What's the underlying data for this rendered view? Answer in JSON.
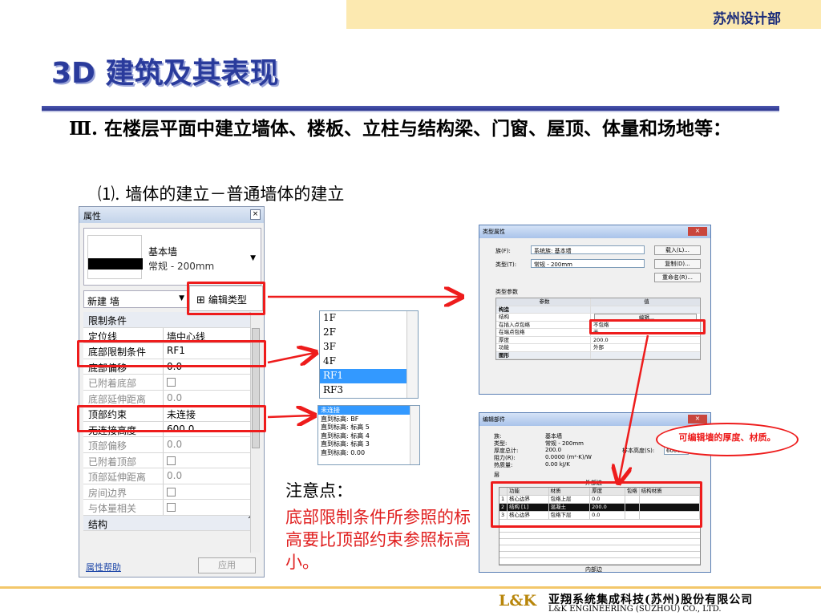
{
  "header": {
    "dept": "苏州设计部"
  },
  "title": "3D 建筑及其表现",
  "section": {
    "heading": "Ⅲ. 在楼层平面中建立墙体、楼板、立柱与结构梁、门窗、屋顶、体量和场地等：",
    "subheading": "⑴.  墙体的建立－普通墙体的建立"
  },
  "props": {
    "title": "属性",
    "type_name": "基本墙",
    "type_sub": "常规 - 200mm",
    "new_label": "新建 墙",
    "edit_type": "编辑类型",
    "rows": [
      {
        "k": "限制条件",
        "v": "",
        "grp": true
      },
      {
        "k": "定位线",
        "v": "墙中心线"
      },
      {
        "k": "底部限制条件",
        "v": "RF1"
      },
      {
        "k": "底部偏移",
        "v": "0.0"
      },
      {
        "k": "已附着底部",
        "v": "",
        "cb": true,
        "dis": true
      },
      {
        "k": "底部延伸距离",
        "v": "0.0",
        "dis": true
      },
      {
        "k": "顶部约束",
        "v": "未连接"
      },
      {
        "k": "无连接高度",
        "v": "600.0"
      },
      {
        "k": "顶部偏移",
        "v": "0.0",
        "dis": true
      },
      {
        "k": "已附着顶部",
        "v": "",
        "cb": true,
        "dis": true
      },
      {
        "k": "顶部延伸距离",
        "v": "0.0",
        "dis": true
      },
      {
        "k": "房间边界",
        "v": "",
        "cb": true,
        "dis": true
      },
      {
        "k": "与体量相关",
        "v": "",
        "cb": true,
        "dis": true
      },
      {
        "k": "结构",
        "v": "",
        "grp": true
      }
    ],
    "help": "属性帮助",
    "apply": "应用"
  },
  "levels": [
    "1F",
    "2F",
    "3F",
    "4F",
    "RF1",
    "RF3"
  ],
  "levels_selected": 4,
  "top_constraints": [
    "未连接",
    "直到标高: BF",
    "直到标高: 标高 5",
    "直到标高: 标高 4",
    "直到标高: 标高 3",
    "直到标高: 0.00"
  ],
  "type_dialog": {
    "title": "类型属性",
    "family_label": "族(F):",
    "family_value": "系统族: 基本墙",
    "type_label": "类型(T):",
    "type_value": "常规 - 200mm",
    "load": "载入(L)...",
    "dup": "复制(D)...",
    "rename": "重命名(R)...",
    "params_label": "类型参数",
    "col_param": "参数",
    "col_value": "值",
    "rows": [
      {
        "a": "构造",
        "b": "",
        "h": true
      },
      {
        "a": "结构",
        "b": "编辑..."
      },
      {
        "a": "在插入点包络",
        "b": "不包络"
      },
      {
        "a": "在端点包络",
        "b": "无"
      },
      {
        "a": "厚度",
        "b": "200.0"
      },
      {
        "a": "功能",
        "b": "外部"
      },
      {
        "a": "图形",
        "b": "",
        "h": true
      }
    ]
  },
  "assembly": {
    "title": "编辑部件",
    "family": "族:",
    "family_v": "基本墙",
    "type": "类型:",
    "type_v": "常规 - 200mm",
    "thick": "厚度总计:",
    "thick_v": "200.0",
    "res": "阻力(R):",
    "res_v": "0.0000 (m²·K)/W",
    "mass": "热质量:",
    "mass_v": "0.00 kJ/K",
    "sample": "样本高度(S):",
    "sample_v": "6000.0",
    "layers_label": "层",
    "ext": "外部边",
    "int": "内部边",
    "cols": [
      "",
      "功能",
      "材质",
      "厚度",
      "包络",
      "结构材质"
    ],
    "layers": [
      {
        "n": "1",
        "f": "核心边界",
        "m": "包络上层",
        "t": "0.0"
      },
      {
        "n": "2",
        "f": "结构 [1]",
        "m": "混凝土",
        "t": "200.0"
      },
      {
        "n": "3",
        "f": "核心边界",
        "m": "包络下层",
        "t": "0.0"
      }
    ]
  },
  "callout": "可编辑墙的厚度、材质。",
  "note": {
    "title": "注意点：",
    "body": "底部限制条件所参照的标高要比顶部约束参照标高小。"
  },
  "footer": {
    "logo": "L&K",
    "cn": "亚翔系统集成科技(苏州)股份有限公司",
    "en": "L&K ENGINEERING (SUZHOU) CO., LTD."
  }
}
